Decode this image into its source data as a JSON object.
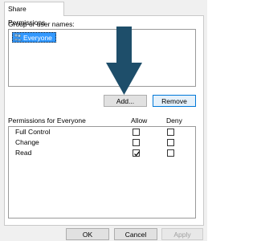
{
  "tab": {
    "label": "Share Permissions"
  },
  "group_section": {
    "label": "Group or user names:",
    "items": [
      {
        "name": "Everyone",
        "selected": true,
        "icon": "user-group-icon"
      }
    ],
    "add_label": "Add...",
    "remove_label": "Remove"
  },
  "permissions": {
    "header": "Permissions for Everyone",
    "col_allow": "Allow",
    "col_deny": "Deny",
    "rows": [
      {
        "name": "Full Control",
        "allow": false,
        "deny": false
      },
      {
        "name": "Change",
        "allow": false,
        "deny": false
      },
      {
        "name": "Read",
        "allow": true,
        "deny": false
      }
    ]
  },
  "footer": {
    "ok_label": "OK",
    "cancel_label": "Cancel",
    "apply_label": "Apply"
  },
  "colors": {
    "selection": "#3399ff",
    "arrow": "#1e4e6a"
  }
}
